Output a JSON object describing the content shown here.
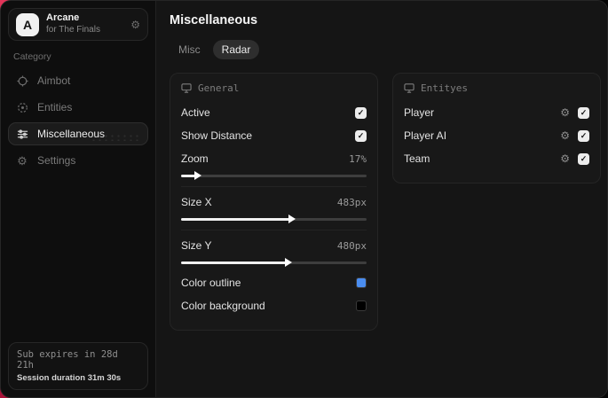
{
  "window": {
    "app": {
      "logo_letter": "A",
      "name": "Arcane",
      "subtitle": "for The Finals"
    }
  },
  "sidebar": {
    "category_label": "Category",
    "items": [
      {
        "label": "Aimbot",
        "icon": "crosshair-icon",
        "active": false
      },
      {
        "label": "Entities",
        "icon": "entities-icon",
        "active": false
      },
      {
        "label": "Miscellaneous",
        "icon": "sliders-icon",
        "active": true
      },
      {
        "label": "Settings",
        "icon": "gear-icon",
        "active": false
      }
    ],
    "footer": {
      "sub_expires": "Sub expires in 28d 21h",
      "session_duration": "Session duration 31m 30s"
    }
  },
  "main": {
    "title": "Miscellaneous",
    "tabs": [
      {
        "label": "Misc",
        "active": false
      },
      {
        "label": "Radar",
        "active": true
      }
    ],
    "panels": {
      "general": {
        "title": "General",
        "rows": {
          "active": {
            "label": "Active",
            "checked": true
          },
          "show_distance": {
            "label": "Show Distance",
            "checked": true
          },
          "zoom": {
            "label": "Zoom",
            "value": "17%",
            "fill_pct": 8
          },
          "size_x": {
            "label": "Size X",
            "value": "483px",
            "fill_pct": 59
          },
          "size_y": {
            "label": "Size Y",
            "value": "480px",
            "fill_pct": 57
          },
          "color_outline": {
            "label": "Color outline",
            "swatch": "#4a8df0"
          },
          "color_background": {
            "label": "Color background",
            "swatch": "#000000"
          }
        }
      },
      "entities": {
        "title": "Entityes",
        "rows": [
          {
            "label": "Player",
            "checked": true
          },
          {
            "label": "Player AI",
            "checked": true
          },
          {
            "label": "Team",
            "checked": true
          }
        ]
      }
    }
  },
  "colors": {
    "accent_red": "#d3244c",
    "outline_blue": "#4a8df0"
  }
}
